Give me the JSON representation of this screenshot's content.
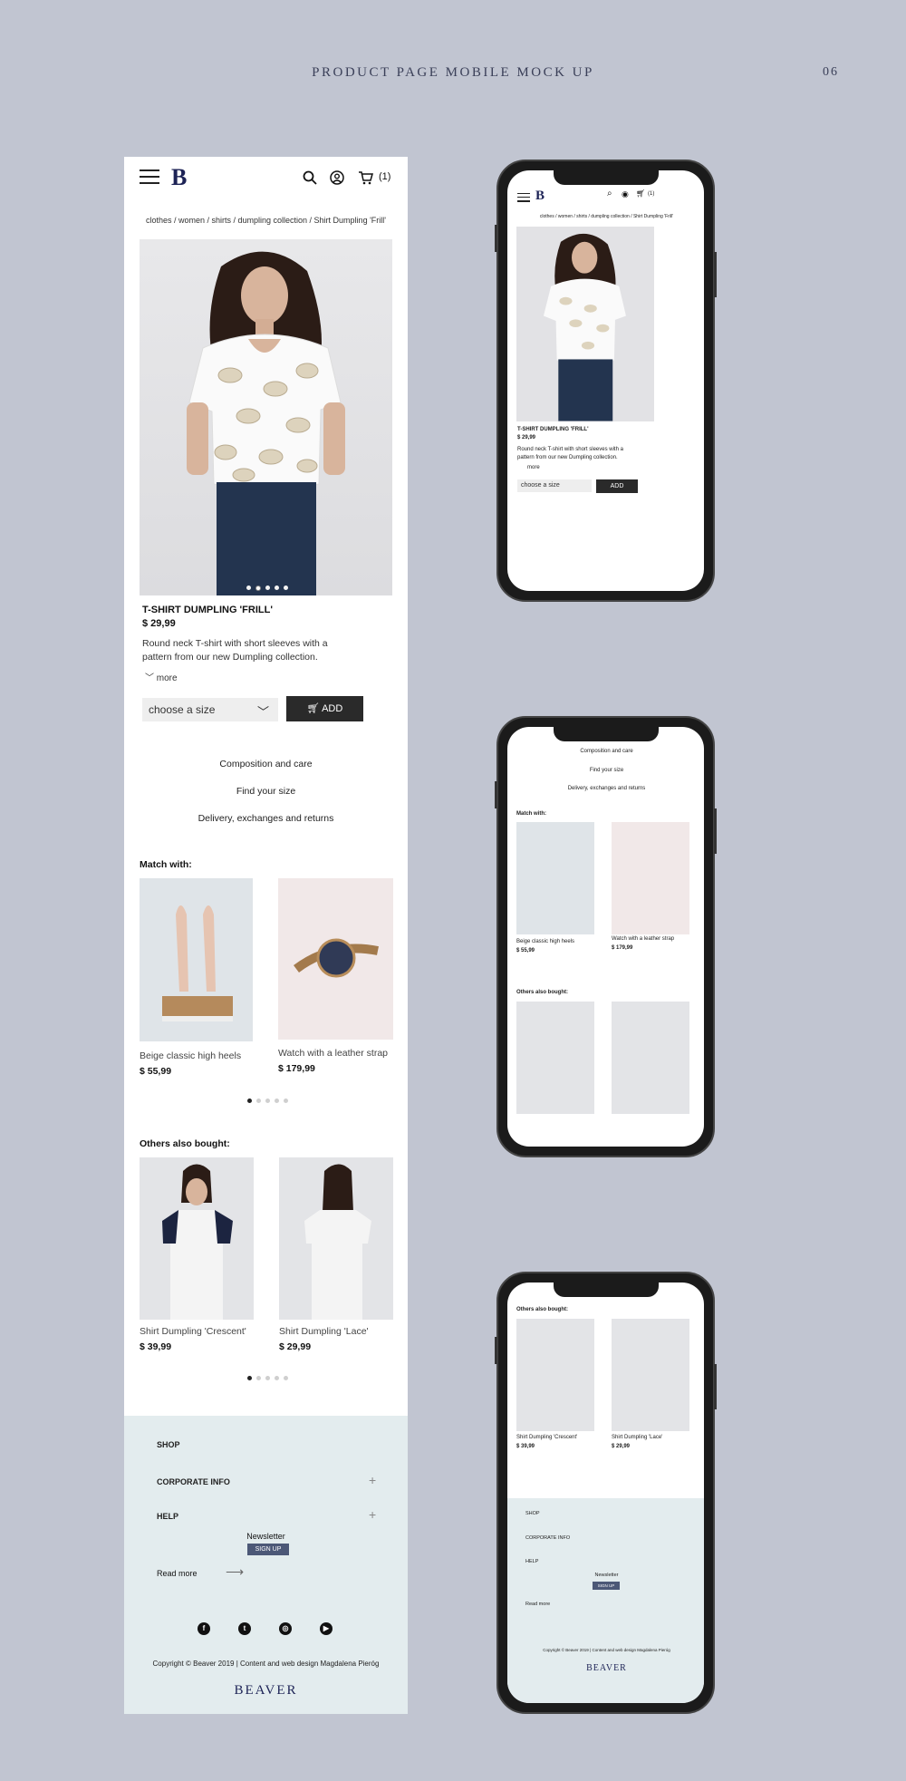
{
  "header": {
    "title": "PRODUCT PAGE MOBILE MOCK UP",
    "page_num": "06"
  },
  "nav": {
    "logo": "B",
    "cart_count": "(1)"
  },
  "breadcrumb": "clothes / women / shirts / dumpling collection / Shirt Dumpling 'Frill'",
  "product": {
    "name": "T-SHIRT DUMPLING 'FRILL'",
    "price": "$ 29,99",
    "description": "Round neck T-shirt with short sleeves with a pattern from our new Dumpling collection.",
    "more": "more",
    "size_placeholder": "choose a size",
    "add_label": "ADD"
  },
  "info_links": [
    "Composition and care",
    "Find your size",
    "Delivery, exchanges and returns"
  ],
  "match": {
    "title": "Match with:",
    "items": [
      {
        "name": "Beige classic high heels",
        "price": "$ 55,99"
      },
      {
        "name": "Watch with a leather strap",
        "price": "$ 179,99"
      }
    ]
  },
  "others": {
    "title": "Others also bought:",
    "items": [
      {
        "name": "Shirt Dumpling 'Crescent'",
        "price": "$ 39,99"
      },
      {
        "name": "Shirt Dumpling 'Lace'",
        "price": "$ 29,99"
      }
    ]
  },
  "footer": {
    "shop": "SHOP",
    "corporate": "CORPORATE INFO",
    "help": "HELP",
    "newsletter": "Newsletter",
    "signup": "SIGN UP",
    "read_more": "Read more",
    "copyright": "Copyright © Beaver 2019 | Content and web design Magdalena Pieróg",
    "brand": "BEAVER"
  },
  "colors": {
    "background": "#c1c5d1",
    "brand_navy": "#1d2356",
    "footer_bg": "#e3ecee",
    "button_dark": "#2a2a2a"
  }
}
